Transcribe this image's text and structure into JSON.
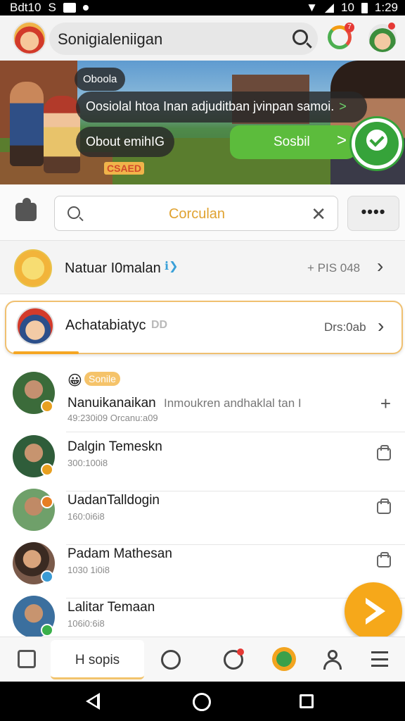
{
  "status_bar": {
    "left_text": "Bdt10",
    "left_text2": "S",
    "time": "1:29",
    "signal_text": "10"
  },
  "app_bar": {
    "search_text": "Sonigialeniigan",
    "notification_count": "7"
  },
  "banner": {
    "pill_small": "Oboola",
    "pill_long": "Oosiolal htoa Inan adjuditban jvinpan samoi.",
    "pill_long_chevron": ">",
    "pill_mid": "Obout emihIG",
    "sos_label": "Sosbil",
    "sos_chevron": ">",
    "badge_text": "CSAED"
  },
  "filter": {
    "search_value": "Corculan",
    "clear_glyph": "✕",
    "more_glyph": "••••"
  },
  "highlight_row": {
    "name": "Natuar I0malan",
    "tag": "ℹ❯",
    "meta": "+ PIS 048",
    "chevron": "›"
  },
  "card_row": {
    "name": "Achatabiatyc",
    "tag": "DD",
    "meta": "Drs:0ab",
    "chevron": "›",
    "progress": 0.17
  },
  "contacts": [
    {
      "badge_emoji": "😀",
      "badge_label": "Sonile",
      "name": "Nanuikanaikan",
      "name_extra": "Inmoukren andhaklal tan I",
      "sub": "49:230i09 Orcanu:a09",
      "action": "+",
      "status_color": "#e8a020",
      "avatar_bg": "#3b6b3a"
    },
    {
      "name": "Dalgin Temeskn",
      "sub": "300:100i8",
      "status_color": "#e8a020",
      "avatar_bg": "#2f5d3a"
    },
    {
      "name": "UadanTalldogin",
      "sub": "160:0i6i8",
      "status_color": "#e67e22",
      "avatar_bg": "#6fa06a"
    },
    {
      "name": "Padam Mathesan",
      "sub": "1030 1i0i8",
      "status_color": "#3a9bd5",
      "avatar_bg": "#7a5a4a"
    },
    {
      "name": "Lalitar Temaan",
      "sub": "106i0:6i8",
      "status_color": "#3ab04a",
      "avatar_bg": "#3b6f9e"
    }
  ],
  "bottom_nav": {
    "active_label": "H sopis",
    "badge_count": "1"
  },
  "colors": {
    "accent": "#f6a81a",
    "green": "#5cbc3c",
    "status_bar": "#000000"
  },
  "icons": [
    "avatar-icon",
    "search-icon",
    "activity-ring-icon",
    "puzzle-icon",
    "more-icon",
    "play-fab-icon",
    "gallery-icon",
    "chat-icon",
    "timer-icon",
    "map-icon",
    "profile-icon",
    "menu-icon",
    "back-icon",
    "home-icon",
    "recents-icon"
  ]
}
